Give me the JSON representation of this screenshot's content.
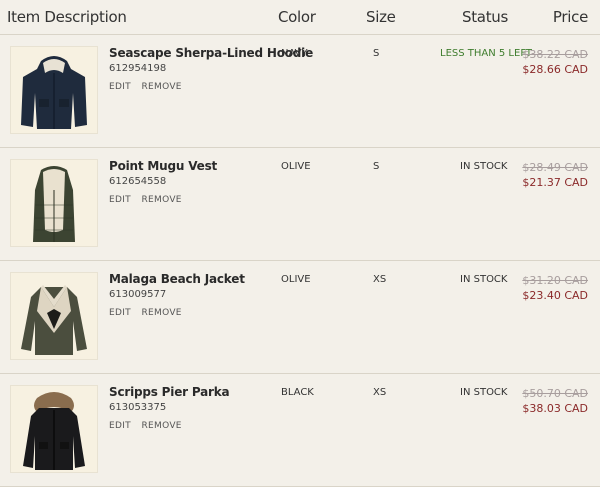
{
  "header": {
    "description": "Item Description",
    "color": "Color",
    "size": "Size",
    "status": "Status",
    "price": "Price"
  },
  "actions": {
    "edit": "EDIT",
    "remove": "REMOVE"
  },
  "items": [
    {
      "name": "Seascape Sherpa-Lined Hoodie",
      "sku": "612954198",
      "color": "NAVY",
      "size": "S",
      "status": "LESS THAN 5 LEFT",
      "old_price": "$38.22 CAD",
      "new_price": "$28.66 CAD",
      "icon": "hoodie-icon"
    },
    {
      "name": "Point Mugu Vest",
      "sku": "612654558",
      "color": "OLIVE",
      "size": "S",
      "status": "IN STOCK",
      "old_price": "$28.49 CAD",
      "new_price": "$21.37 CAD",
      "icon": "vest-icon"
    },
    {
      "name": "Malaga Beach Jacket",
      "sku": "613009577",
      "color": "OLIVE",
      "size": "XS",
      "status": "IN STOCK",
      "old_price": "$31.20 CAD",
      "new_price": "$23.40 CAD",
      "icon": "jacket-icon"
    },
    {
      "name": "Scripps Pier Parka",
      "sku": "613053375",
      "color": "BLACK",
      "size": "XS",
      "status": "IN STOCK",
      "old_price": "$50.70 CAD",
      "new_price": "$38.03 CAD",
      "icon": "parka-icon"
    }
  ],
  "colors": {
    "accent_red": "#8b2a2a",
    "status_low": "#3f7d2e",
    "strike": "#a89e9e",
    "background": "#f3f0e9"
  }
}
